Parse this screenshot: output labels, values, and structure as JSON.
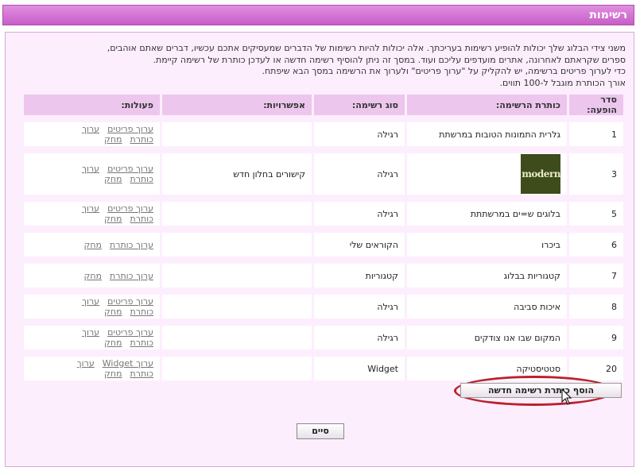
{
  "page": {
    "title": "רשימות"
  },
  "intro": {
    "lines": [
      "משני צידי הבלוג שלך יכולות להופיע רשימות בעריכתך. אלה יכולות להיות רשימות של הדברים שמעסיקים אתכם עכשיו, דברים שאתם אוהבים,",
      "ספרים שקראתם לאחרונה, אתרים מועדפים עליכם ועוד. במסך זה ניתן להוסיף רשימה חדשה או לעדכן כותרת של רשימה קיימת.",
      "כדי לערוך פריטים ברשימה, יש להקליק על \"ערוך פריטים\" ולערוך את הרשימה במסך הבא שיפתח.",
      "אורך הכותרת מוגבל ל-100 תווים."
    ]
  },
  "table": {
    "headers": [
      "סדר הופעה:",
      "כותרת הרשימה:",
      "סוג רשימה:",
      "אפשרויות:",
      "פעולות:"
    ],
    "rows": [
      {
        "order": "1",
        "title": "גלרית התמונות הטובות במרשתת",
        "type": "רגילה",
        "options": "",
        "actions": [
          "ערוך פריטים",
          "ערוך כותרת",
          "מחק"
        ]
      },
      {
        "order": "3",
        "title": "",
        "image_text": "post modern",
        "type": "רגילה",
        "options": "קישורים בחלון חדש",
        "actions": [
          "ערוך פריטים",
          "ערוך כותרת",
          "מחק"
        ]
      },
      {
        "order": "5",
        "title": "בלוגים ש=ים במרשתתת",
        "type": "רגילה",
        "options": "",
        "actions": [
          "ערוך פריטים",
          "ערוך כותרת",
          "מחק"
        ]
      },
      {
        "order": "6",
        "title": "ביכרו",
        "type": "הקוראים שלי",
        "options": "",
        "actions": [
          "ערוך כותרת",
          "מחק"
        ]
      },
      {
        "order": "7",
        "title": "קטגוריות בבלוג",
        "type": "קטגוריות",
        "options": "",
        "actions": [
          "ערוך כותרת",
          "מחק"
        ]
      },
      {
        "order": "8",
        "title": "איכות סביבה",
        "type": "רגילה",
        "options": "",
        "actions": [
          "ערוך פריטים",
          "ערוך כותרת",
          "מחק"
        ]
      },
      {
        "order": "9",
        "title": "המקום שבו אנו צודקים",
        "type": "רגילה",
        "options": "",
        "actions": [
          "ערוך פריטים",
          "ערוך כותרת",
          "מחק"
        ]
      },
      {
        "order": "20",
        "title": "סטטיסטיקה",
        "type": "Widget",
        "options": "",
        "actions": [
          "ערוך Widget",
          "ערוך כותרת",
          "מחק"
        ]
      }
    ]
  },
  "buttons": {
    "add_new": "הוסף כותרת רשימה חדשה",
    "done": "סיים"
  },
  "colors": {
    "titlebar": "#c85ec8",
    "panel": "#fdeefd",
    "header_cell": "#ecc6ec",
    "highlight": "#b8232d"
  }
}
